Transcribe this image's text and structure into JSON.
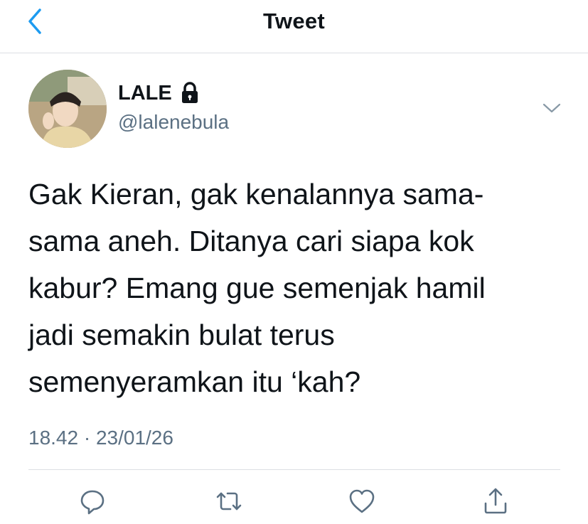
{
  "header": {
    "title": "Tweet"
  },
  "tweet": {
    "name": "LALE",
    "handle": "@lalenebula",
    "text": "Gak Kieran, gak kenalannya sama-\nsama aneh. Ditanya cari siapa kok\nkabur? Emang gue semenjak hamil\njadi semakin bulat terus\nsemenyeramkan itu ‘kah?",
    "timestamp": "18.42 · 23/01/26",
    "protected": true
  },
  "icons": {
    "back": "chevron-left-icon",
    "lock": "lock-icon",
    "menu": "chevron-down-icon",
    "reply": "reply-icon",
    "retweet": "retweet-icon",
    "like": "heart-icon",
    "share": "share-icon"
  },
  "colors": {
    "accent": "#1d9bf0",
    "secondary_text": "#5b7083",
    "icon": "#5b7083"
  }
}
